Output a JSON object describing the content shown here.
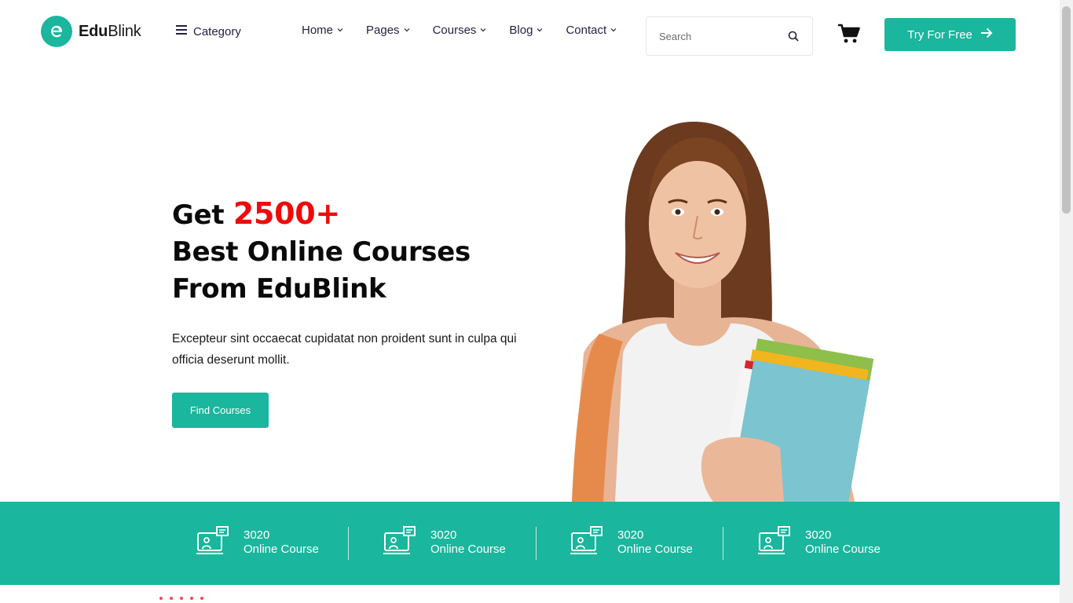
{
  "header": {
    "logo": {
      "bold": "Edu",
      "light": "Blink"
    },
    "category_label": "Category",
    "nav": [
      {
        "label": "Home"
      },
      {
        "label": "Pages"
      },
      {
        "label": "Courses"
      },
      {
        "label": "Blog"
      },
      {
        "label": "Contact"
      }
    ],
    "search_placeholder": "Search",
    "cta_label": "Try For Free"
  },
  "hero": {
    "title_line1_prefix": "Get ",
    "title_accent": "2500+",
    "title_line2": "Best Online Courses",
    "title_line3": "From EduBlink",
    "description": "Excepteur sint occaecat cupidatat non proident sunt in culpa qui officia deserunt mollit.",
    "button_label": "Find Courses"
  },
  "stats": [
    {
      "value": "3020",
      "label": "Online Course"
    },
    {
      "value": "3020",
      "label": "Online Course"
    },
    {
      "value": "3020",
      "label": "Online Course"
    },
    {
      "value": "3020",
      "label": "Online Course"
    }
  ],
  "colors": {
    "brand": "#1ab69d",
    "accent": "#ee0a0a",
    "text": "#231f40"
  }
}
